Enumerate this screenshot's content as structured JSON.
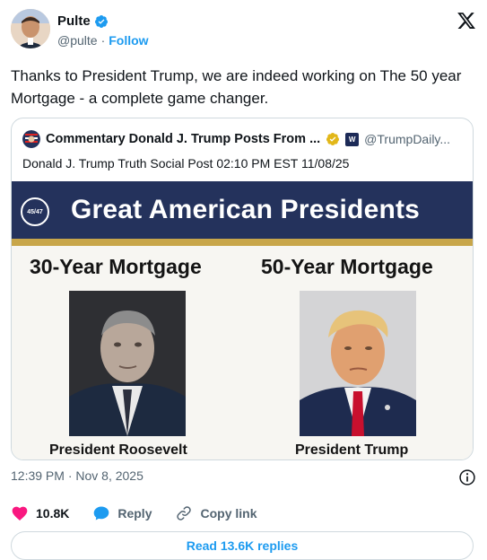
{
  "author": {
    "display_name": "Pulte",
    "handle": "@pulte",
    "separator": "·",
    "follow_label": "Follow"
  },
  "tweet": {
    "text": "Thanks to President Trump, we are indeed working on The 50 year Mortgage  - a complete game changer."
  },
  "quoted": {
    "name": "Commentary Donald J. Trump Posts From ...",
    "handle": "@TrumpDaily...",
    "subtitle": "Donald J. Trump Truth Social Post 02:10 PM EST 11/08/25",
    "image": {
      "banner_title": "Great American Presidents",
      "seal_text": "45/47",
      "left_heading": "30-Year Mortgage",
      "right_heading": "50-Year Mortgage",
      "left_caption": "President Roosevelt",
      "right_caption": "President Trump"
    }
  },
  "meta": {
    "timestamp": "12:39 PM · Nov 8, 2025"
  },
  "actions": {
    "likes": "10.8K",
    "reply_label": "Reply",
    "copy_link_label": "Copy link"
  },
  "read_replies_label": "Read 13.6K replies",
  "colors": {
    "accent": "#1d9bf0",
    "like": "#f91880",
    "banner": "#24325c",
    "gold": "#c8a64a"
  },
  "icons": [
    "verified-badge-icon",
    "x-logo-icon",
    "gold-check-icon",
    "info-icon",
    "heart-icon",
    "reply-bubble-icon",
    "link-icon"
  ]
}
